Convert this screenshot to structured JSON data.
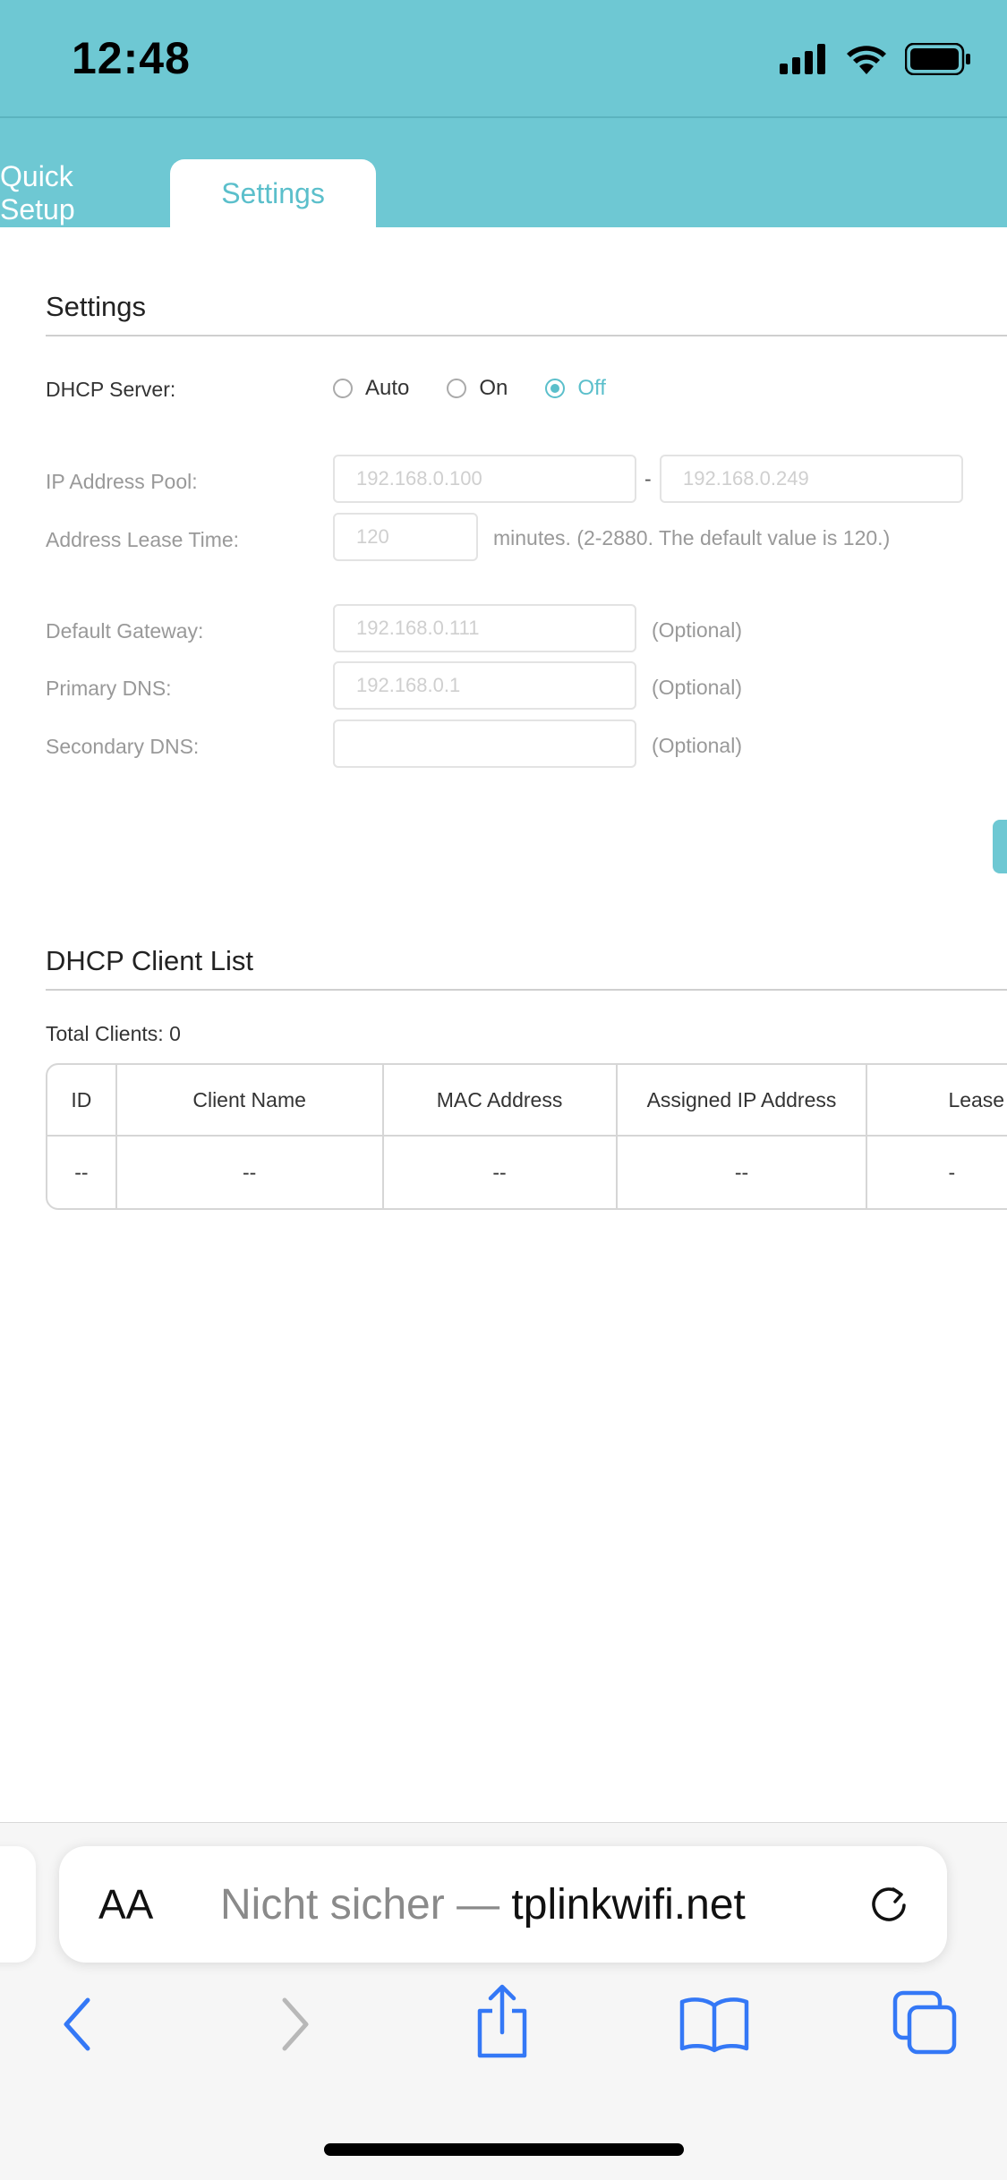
{
  "status_bar": {
    "time": "12:48"
  },
  "tabs": [
    {
      "label": "Quick Setup"
    },
    {
      "label": "Settings"
    }
  ],
  "settings": {
    "title": "Settings",
    "dhcp_server_label": "DHCP Server:",
    "radio_options": [
      "Auto",
      "On",
      "Off"
    ],
    "selected": "Off",
    "ip_pool_label": "IP Address Pool:",
    "ip_pool_start": "192.168.0.100",
    "ip_pool_sep": "-",
    "ip_pool_end": "192.168.0.249",
    "lease_label": "Address Lease Time:",
    "lease_value": "120",
    "lease_hint": "minutes. (2-2880. The default value is 120.)",
    "gateway_label": "Default Gateway:",
    "gateway_value": "192.168.0.111",
    "primary_dns_label": "Primary DNS:",
    "primary_dns_value": "192.168.0.1",
    "secondary_dns_label": "Secondary DNS:",
    "secondary_dns_value": "",
    "optional": "(Optional)"
  },
  "client_list": {
    "title": "DHCP Client List",
    "total_label": "Total Clients:",
    "total_value": "0",
    "columns": [
      "ID",
      "Client Name",
      "MAC Address",
      "Assigned IP Address",
      "Lease"
    ],
    "rows": [
      [
        "--",
        "--",
        "--",
        "--",
        "-"
      ]
    ]
  },
  "browser": {
    "aa_label": "AA",
    "url_prefix": "Nicht sicher — ",
    "url_host": "tplinkwifi.net"
  },
  "colors": {
    "accent": "#6ec8d3",
    "accent_text": "#5bbfcb",
    "ios_blue": "#3478f6"
  }
}
